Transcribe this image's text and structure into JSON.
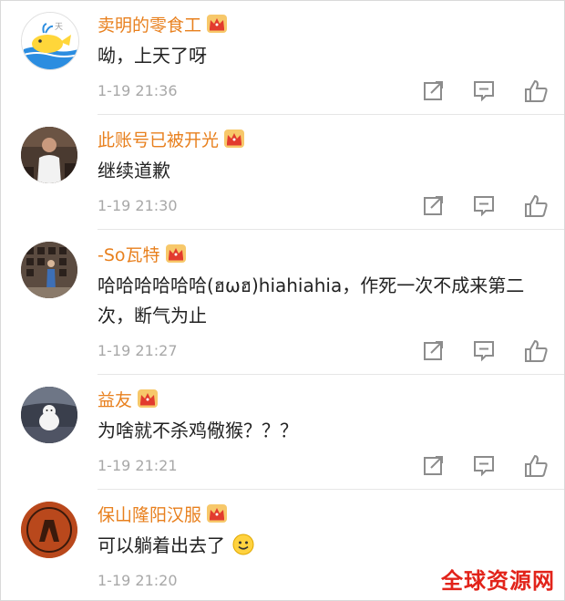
{
  "comments": [
    {
      "name": "卖明的零食工",
      "text": "呦，上天了呀",
      "time": "1-19 21:36",
      "avatar_icon": "whale-avatar"
    },
    {
      "name": "此账号已被开光",
      "text": "继续道歉",
      "time": "1-19 21:30",
      "avatar_icon": "person-photo-avatar"
    },
    {
      "name": "-So瓦特",
      "text": "哈哈哈哈哈哈(ฮωฮ)hiahiahia，作死一次不成来第二次，断气为止",
      "time": "1-19 21:27",
      "avatar_icon": "photo-wall-avatar"
    },
    {
      "name": "益友",
      "text": "为啥就不杀鸡儆猴？？？",
      "time": "1-19 21:21",
      "avatar_icon": "white-dog-avatar"
    },
    {
      "name": "保山隆阳汉服",
      "text": "可以躺着出去了",
      "time": "1-19 21:20",
      "avatar_icon": "seal-emblem-avatar"
    }
  ],
  "watermark": "全球资源网",
  "colors": {
    "name": "#e8801e",
    "text": "#222222",
    "time": "#a8a8a8",
    "icon": "#8c8c8c",
    "watermark": "#e2231a"
  }
}
